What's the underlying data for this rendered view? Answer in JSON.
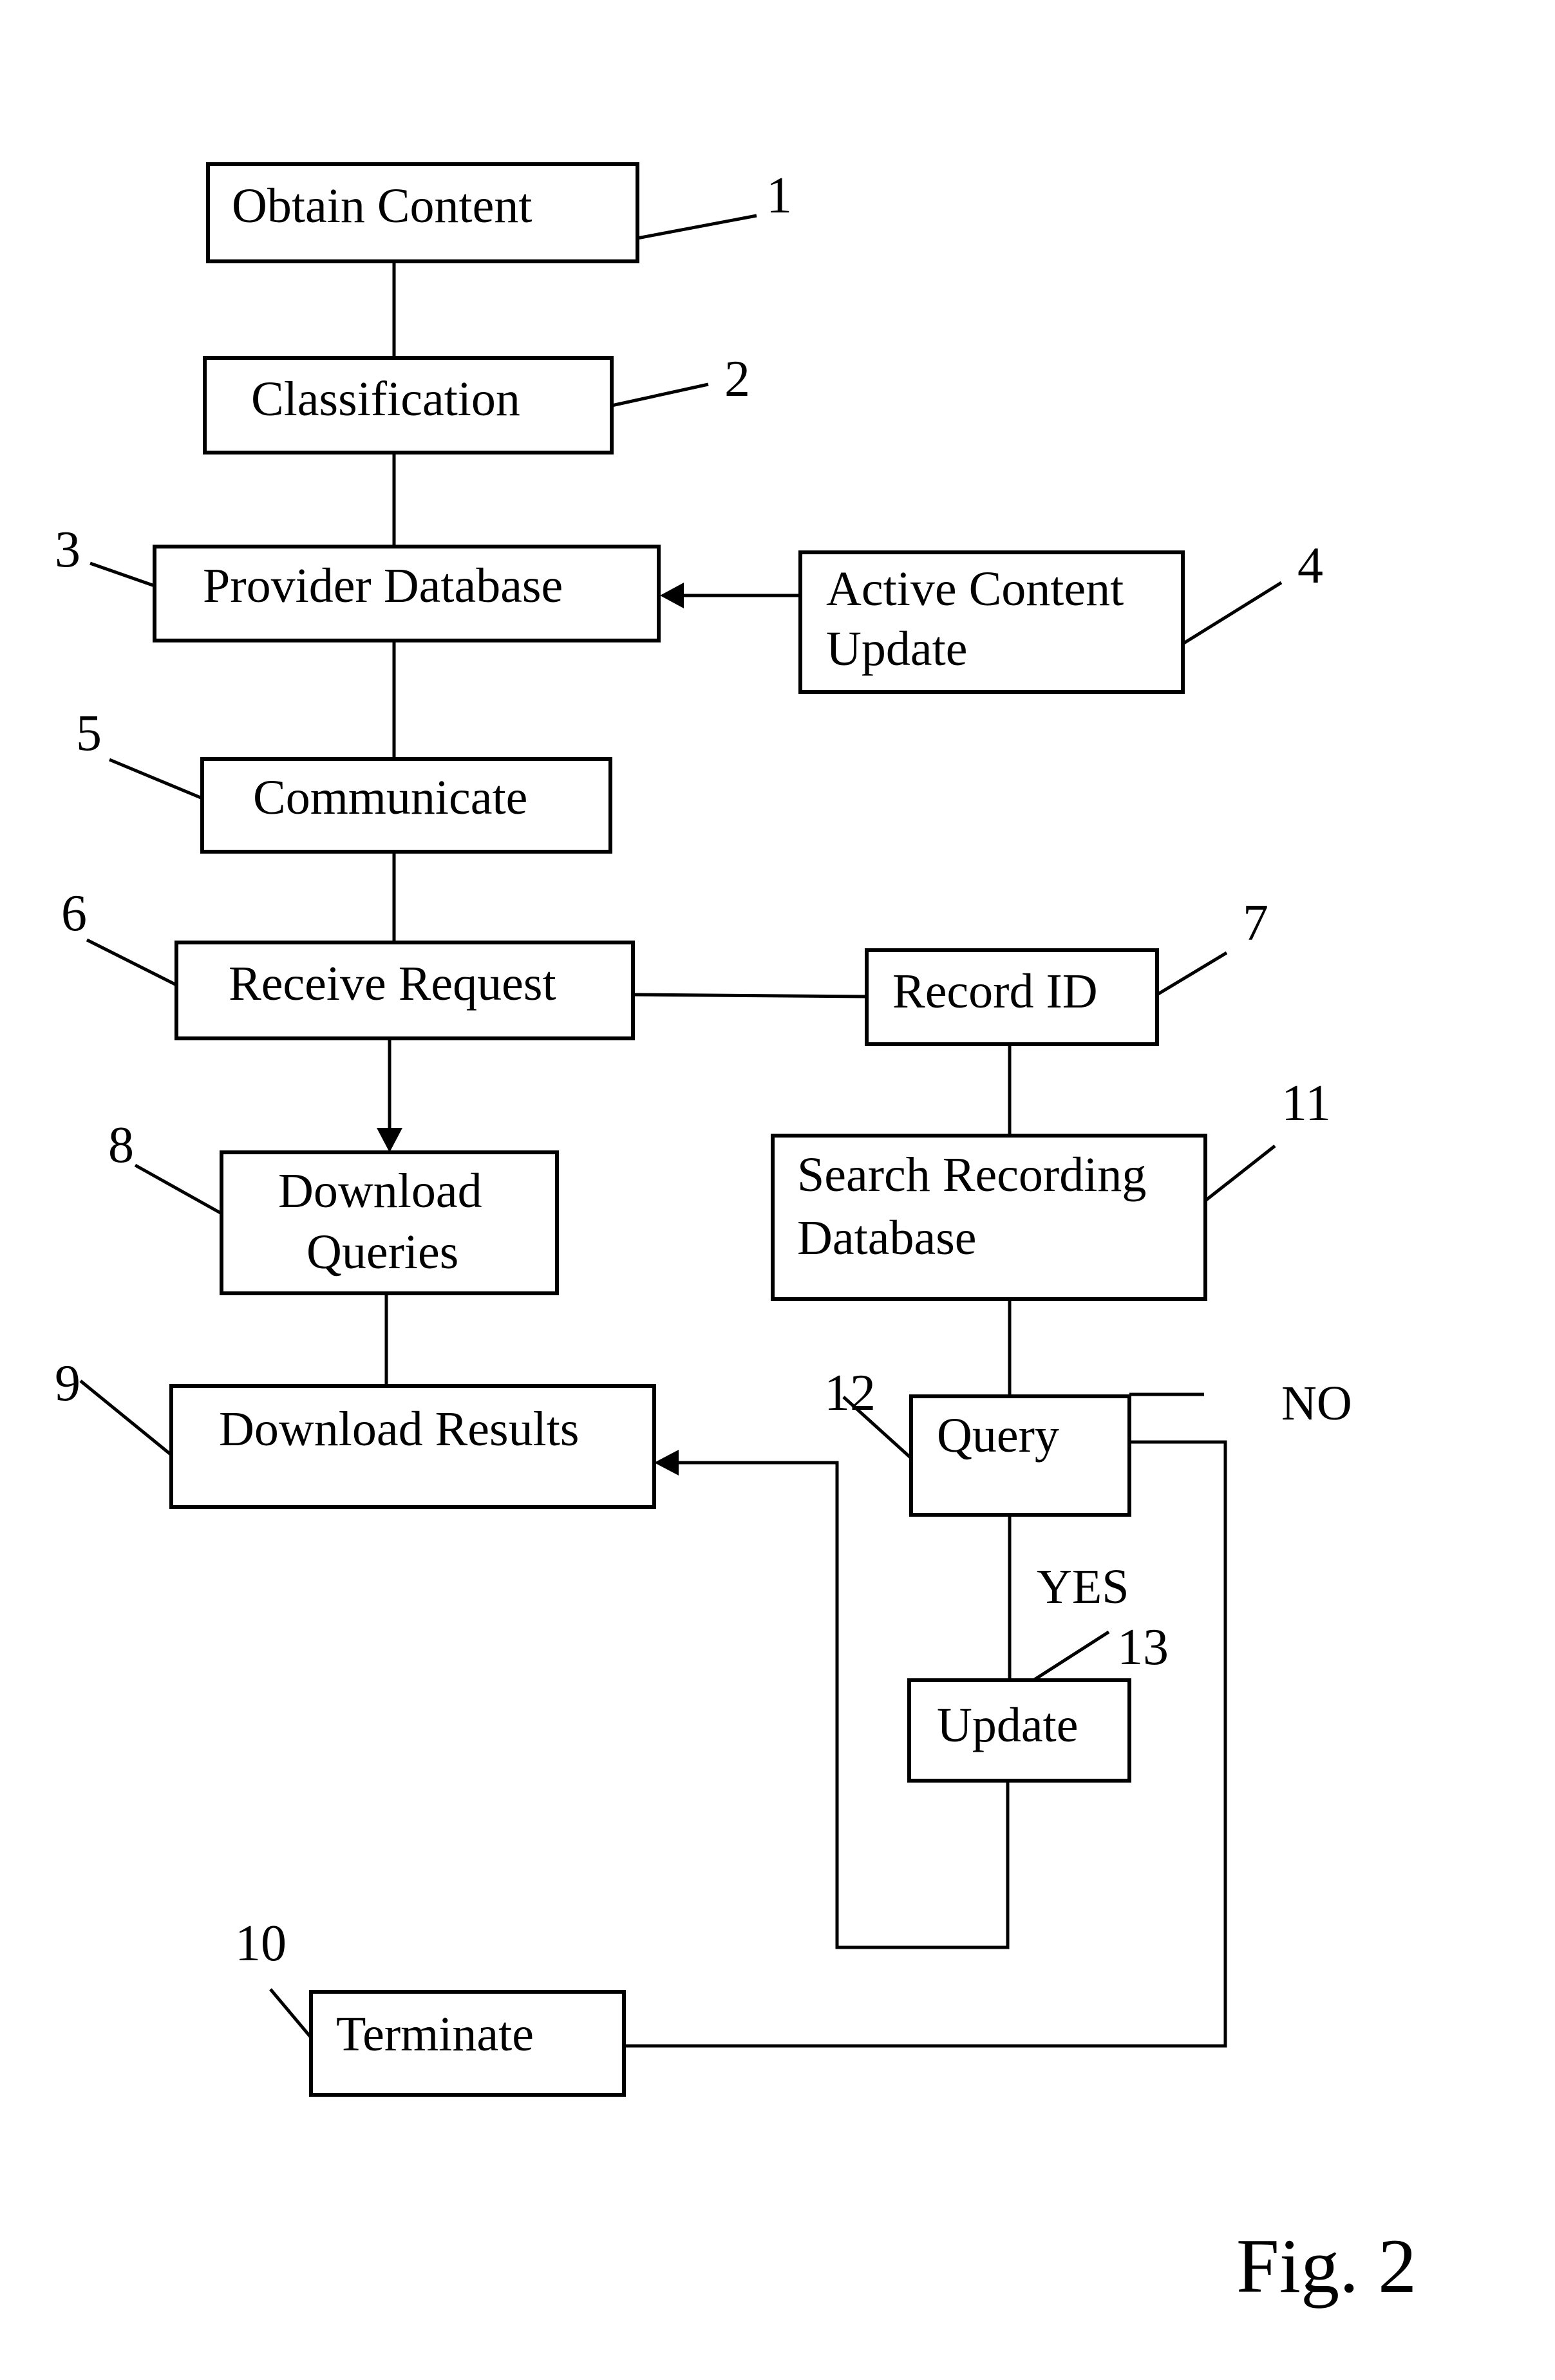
{
  "figure_label": "Fig. 2",
  "nodes": {
    "obtain_content": {
      "ref": "1",
      "lines": [
        "Obtain Content"
      ]
    },
    "classification": {
      "ref": "2",
      "lines": [
        "Classification"
      ]
    },
    "provider_database": {
      "ref": "3",
      "lines": [
        "Provider Database"
      ]
    },
    "active_content_update": {
      "ref": "4",
      "lines": [
        "Active Content",
        "Update"
      ]
    },
    "communicate": {
      "ref": "5",
      "lines": [
        "Communicate"
      ]
    },
    "receive_request": {
      "ref": "6",
      "lines": [
        "Receive Request"
      ]
    },
    "record_id": {
      "ref": "7",
      "lines": [
        "Record ID"
      ]
    },
    "download_queries": {
      "ref": "8",
      "lines": [
        "Download",
        "Queries"
      ]
    },
    "download_results": {
      "ref": "9",
      "lines": [
        "Download Results"
      ]
    },
    "terminate": {
      "ref": "10",
      "lines": [
        "Terminate"
      ]
    },
    "search_recording_database": {
      "ref": "11",
      "lines": [
        "Search Recording",
        "Database"
      ]
    },
    "query": {
      "ref": "12",
      "lines": [
        "Query"
      ]
    },
    "update": {
      "ref": "13",
      "lines": [
        "Update"
      ]
    }
  },
  "branch_labels": {
    "yes": "YES",
    "no": "NO"
  },
  "edges": [
    {
      "from": "obtain_content",
      "to": "classification",
      "arrow": false
    },
    {
      "from": "classification",
      "to": "provider_database",
      "arrow": false
    },
    {
      "from": "active_content_update",
      "to": "provider_database",
      "arrow": true
    },
    {
      "from": "provider_database",
      "to": "communicate",
      "arrow": false
    },
    {
      "from": "communicate",
      "to": "receive_request",
      "arrow": false
    },
    {
      "from": "receive_request",
      "to": "record_id",
      "arrow": false
    },
    {
      "from": "receive_request",
      "to": "download_queries",
      "arrow": true
    },
    {
      "from": "download_queries",
      "to": "download_results",
      "arrow": false
    },
    {
      "from": "record_id",
      "to": "search_recording_database",
      "arrow": false
    },
    {
      "from": "search_recording_database",
      "to": "query",
      "arrow": false
    },
    {
      "from": "query",
      "to": "update",
      "arrow": false,
      "label": "YES"
    },
    {
      "from": "update",
      "to": "download_results",
      "arrow": true
    },
    {
      "from": "query",
      "to": "terminate",
      "arrow": false,
      "label": "NO"
    }
  ]
}
